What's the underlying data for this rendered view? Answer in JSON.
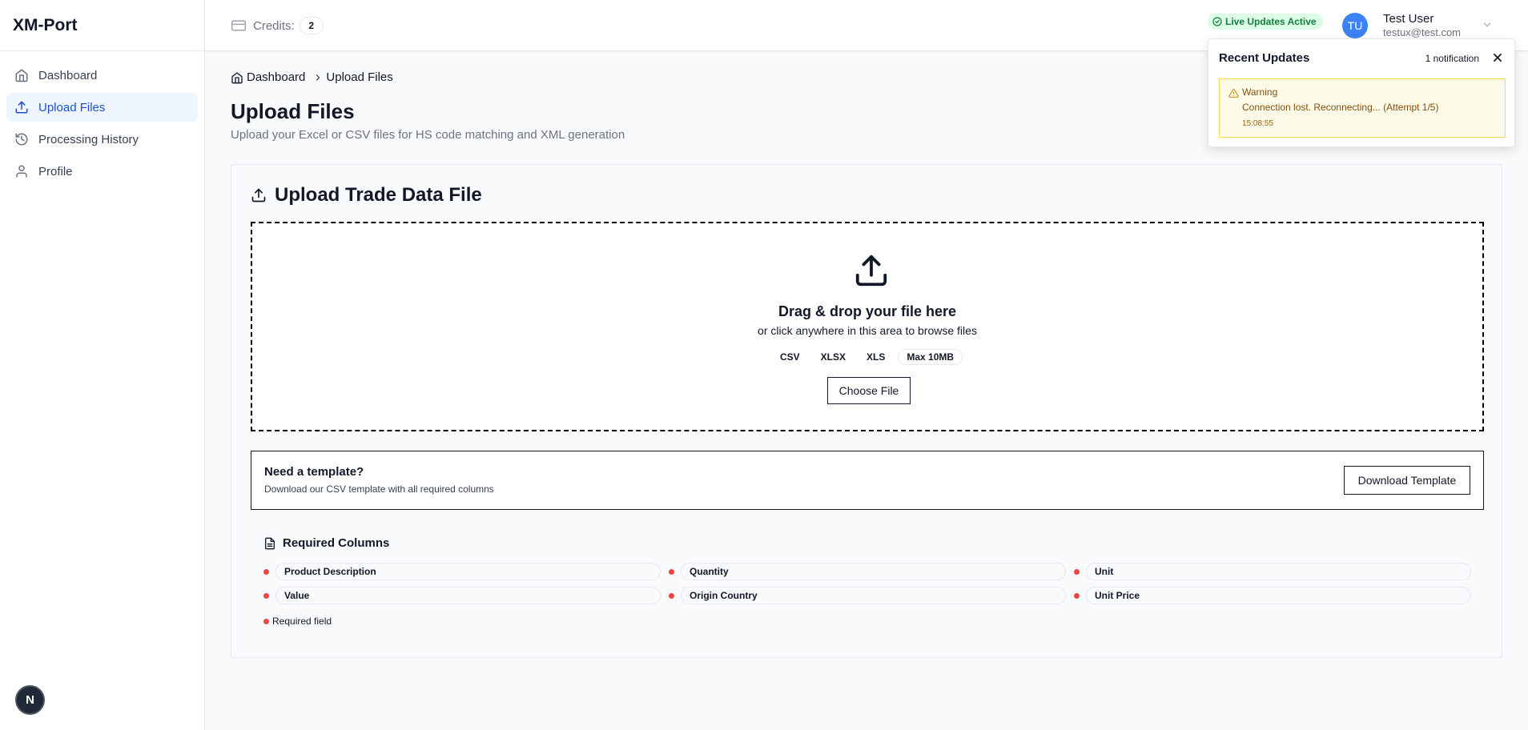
{
  "app": {
    "name": "XM-Port"
  },
  "sidebar": {
    "items": [
      {
        "label": "Dashboard",
        "icon": "home-icon",
        "active": false
      },
      {
        "label": "Upload Files",
        "icon": "upload-icon",
        "active": true
      },
      {
        "label": "Processing History",
        "icon": "history-icon",
        "active": false
      },
      {
        "label": "Profile",
        "icon": "user-icon",
        "active": false
      }
    ],
    "dev_button": "N"
  },
  "header": {
    "credits_label": "Credits:",
    "credits_count": "2",
    "live_badge": "Live Updates Active",
    "user": {
      "initials": "TU",
      "name": "Test User",
      "email": "testux@test.com"
    }
  },
  "breadcrumb": {
    "home": "Dashboard",
    "current": "Upload Files"
  },
  "page": {
    "title": "Upload Files",
    "subtitle": "Upload your Excel or CSV files for HS code matching and XML generation"
  },
  "upload_card": {
    "title": "Upload Trade Data File",
    "dropzone": {
      "title": "Drag & drop your file here",
      "subtitle": "or click anywhere in this area to browse files",
      "file_types": [
        "CSV",
        "XLSX",
        "XLS"
      ],
      "max_size": "Max 10MB",
      "button": "Choose File"
    },
    "template": {
      "title": "Need a template?",
      "description": "Download our CSV template with all required columns",
      "button": "Download Template"
    },
    "required": {
      "title": "Required Columns",
      "columns": [
        "Product Description",
        "Quantity",
        "Unit",
        "Value",
        "Origin Country",
        "Unit Price"
      ],
      "legend": "Required field"
    }
  },
  "notifications": {
    "title": "Recent Updates",
    "count": "1 notification",
    "items": [
      {
        "level": "Warning",
        "message": "Connection lost. Reconnecting... (Attempt 1/5)",
        "time": "15:08:55"
      }
    ]
  },
  "colors": {
    "accent": "#1d4ed8",
    "avatar": "#3b82f6",
    "live": "#15803d",
    "required_dot": "#ef4444",
    "warning_bg": "#fefce8"
  }
}
